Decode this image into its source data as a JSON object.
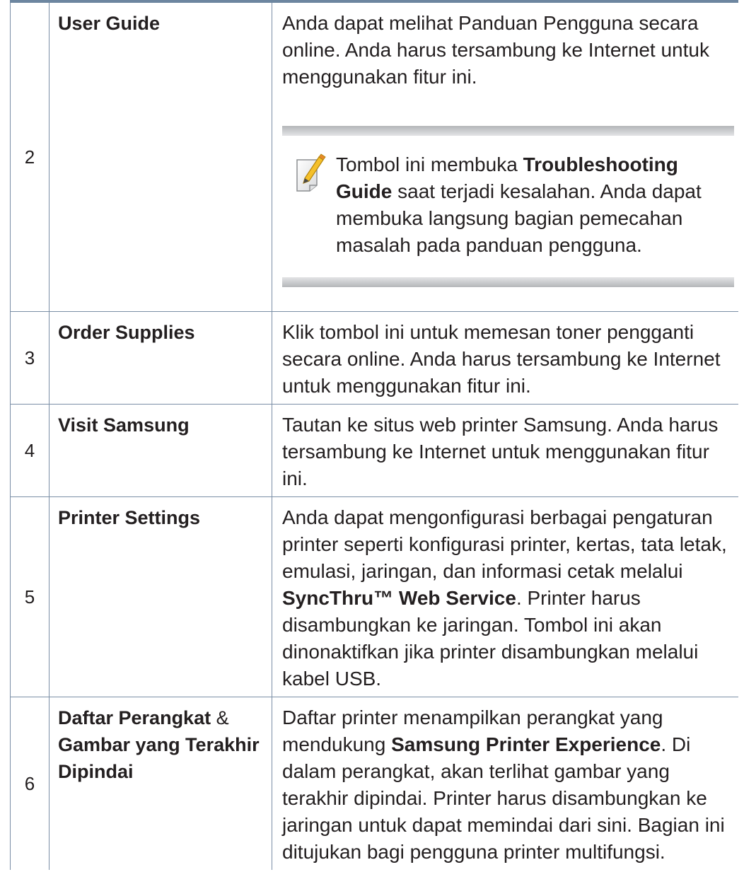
{
  "rows": [
    {
      "num": "2",
      "name": "User Guide",
      "desc": "Anda dapat melihat Panduan Pengguna secara online. Anda harus tersambung ke Internet untuk menggunakan fitur ini.",
      "note": {
        "pre": "Tombol ini membuka ",
        "bold": "Troubleshooting Guide",
        "post": " saat terjadi kesalahan. Anda dapat membuka langsung bagian pemecahan masalah pada panduan pengguna."
      }
    },
    {
      "num": "3",
      "name": "Order Supplies",
      "desc": "Klik tombol ini untuk memesan toner pengganti secara online. Anda harus tersambung ke Internet untuk menggunakan fitur ini."
    },
    {
      "num": "4",
      "name": "Visit Samsung",
      "desc": "Tautan ke situs web printer Samsung. Anda harus tersambung ke Internet untuk menggunakan fitur ini."
    },
    {
      "num": "5",
      "name": "Printer Settings",
      "desc_pre": "Anda dapat mengonfigurasi berbagai pengaturan printer seperti konfigurasi printer, kertas, tata letak, emulasi, jaringan, dan informasi cetak melalui ",
      "desc_bold": "SyncThru™ Web Service",
      "desc_post": ". Printer harus disambungkan ke jaringan. Tombol ini akan dinonaktifkan jika printer disambungkan melalui kabel USB."
    },
    {
      "num": "6",
      "name_part1": "Daftar Perangkat",
      "name_amp": " & ",
      "name_part2": "Gambar yang Terakhir Dipindai",
      "desc_pre": "Daftar printer menampilkan perangkat yang mendukung ",
      "desc_bold": "Samsung Printer Experience",
      "desc_post": ". Di dalam perangkat, akan terlihat gambar yang terakhir dipindai. Printer harus disambungkan ke jaringan untuk dapat memindai dari sini. Bagian ini ditujukan bagi pengguna printer multifungsi."
    }
  ],
  "icons": {
    "note": "note-pencil-icon"
  }
}
